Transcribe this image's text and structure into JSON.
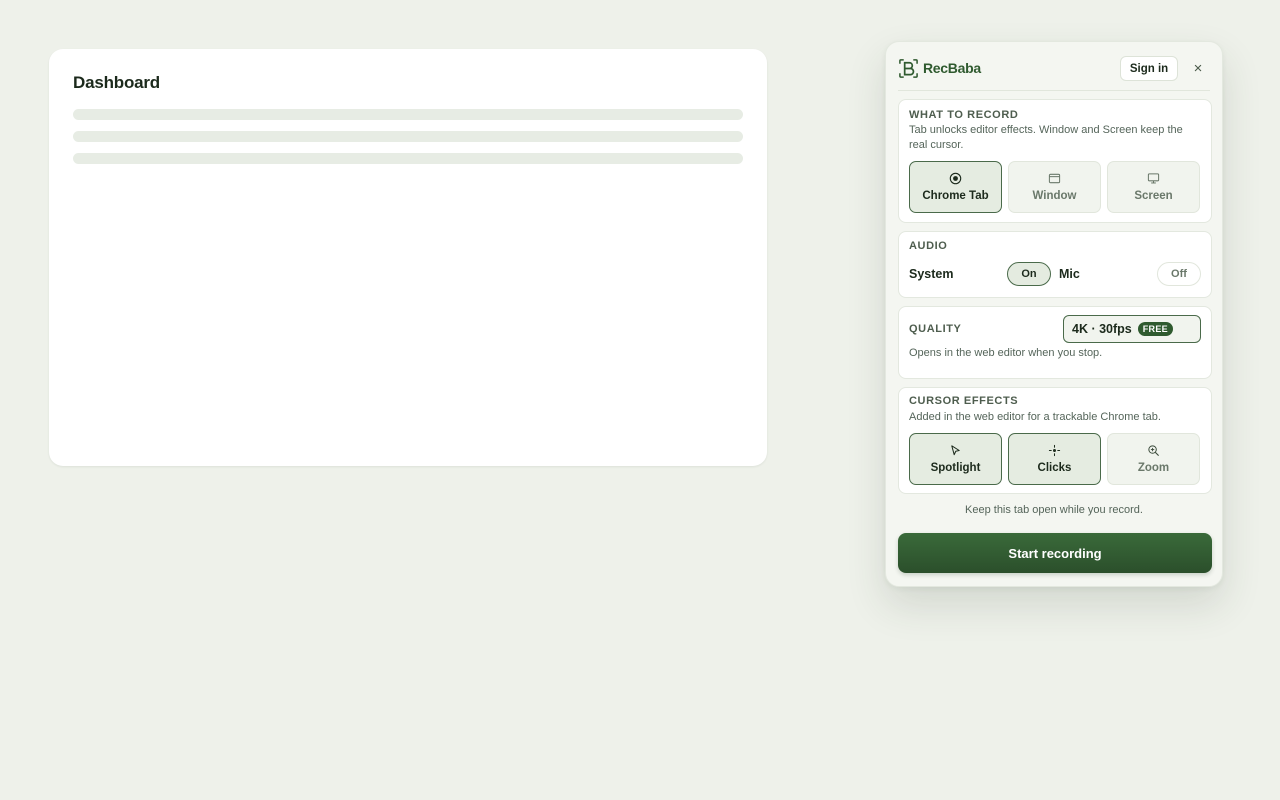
{
  "page": {
    "title": "Dashboard"
  },
  "popup": {
    "brand": "RecBaba",
    "sign_in": "Sign in",
    "close_glyph": "×",
    "what_to_record": {
      "title": "WHAT TO RECORD",
      "description": "Tab unlocks editor effects. Window and Screen keep the real cursor.",
      "options": [
        {
          "label": "Chrome Tab",
          "icon": "record-dot-icon",
          "selected": true
        },
        {
          "label": "Window",
          "icon": "window-icon",
          "selected": false
        },
        {
          "label": "Screen",
          "icon": "monitor-icon",
          "selected": false
        }
      ]
    },
    "audio": {
      "title": "AUDIO",
      "system_label": "System",
      "system_state": "On",
      "mic_label": "Mic",
      "mic_state": "Off"
    },
    "quality": {
      "title": "QUALITY",
      "value": "4K · 30fps",
      "badge": "FREE",
      "description": "Opens in the web editor when you stop."
    },
    "cursor_effects": {
      "title": "CURSOR EFFECTS",
      "description": "Added in the web editor for a trackable Chrome tab.",
      "options": [
        {
          "label": "Spotlight",
          "icon": "cursor-arrow-icon",
          "selected": true
        },
        {
          "label": "Clicks",
          "icon": "click-burst-icon",
          "selected": true
        },
        {
          "label": "Zoom",
          "icon": "zoom-icon",
          "selected": false
        }
      ]
    },
    "hint": "Keep this tab open while you record.",
    "start_button": "Start recording"
  },
  "colors": {
    "accent": "#2f5a2f",
    "background": "#eef1ea",
    "panel": "#f4f6f1"
  }
}
